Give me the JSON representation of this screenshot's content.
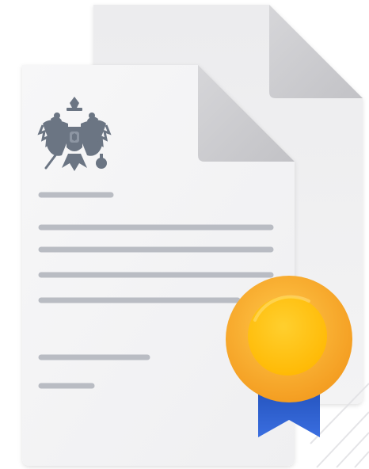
{
  "illustration": {
    "subject": "official-document-with-award-seal",
    "emblem_icon": "double-headed-eagle-emblem-icon",
    "seal_icon": "award-medal-icon",
    "colors": {
      "paper": "#f2f2f3",
      "paper_back": "#e9e9eb",
      "fold": "#c9c9cc",
      "text_line": "#b9bcc3",
      "emblem": "#6b7583",
      "medal_outer": "#f5a62a",
      "medal_inner": "#ffc20e",
      "ribbon": "#2d5fcf"
    }
  }
}
